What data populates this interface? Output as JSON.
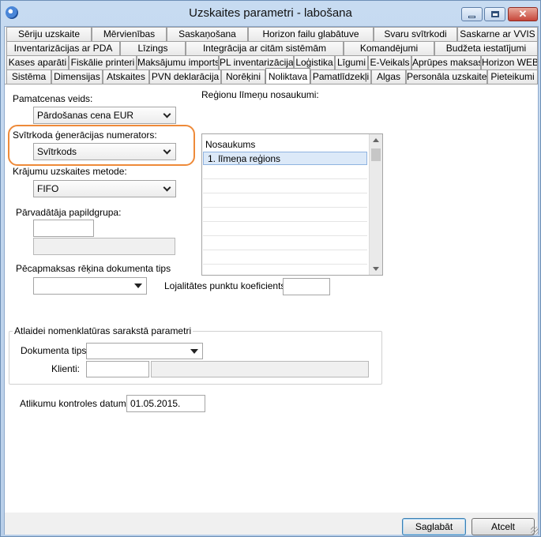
{
  "window": {
    "title": "Uzskaites parametri - labošana",
    "close_glyph": "✕"
  },
  "tabs": {
    "row1": [
      "Sēriju uzskaite",
      "Mērvienības",
      "Saskaņošana",
      "Horizon failu glabātuve",
      "Svaru svītrkodi",
      "Saskarne ar VVIS"
    ],
    "row2": [
      "Inventarizācijas ar PDA",
      "Līzings",
      "Integrācija ar citām sistēmām",
      "Komandējumi",
      "Budžeta iestatījumi"
    ],
    "row3": [
      "Kases aparāti",
      "Fiskālie printeri",
      "Maksājumu imports",
      "PL inventarizācija",
      "Loģistika",
      "Līgumi",
      "E-Veikals",
      "Aprūpes maksas",
      "Horizon WEB"
    ],
    "row4": [
      "Sistēma",
      "Dimensijas",
      "Atskaites",
      "PVN deklarācija",
      "Norēķini",
      "Noliktava",
      "Pamatlīdzekļi",
      "Algas",
      "Personāla uzskaite",
      "Pieteikumi"
    ],
    "active": "Noliktava"
  },
  "form": {
    "pamatcenas_label": "Pamatcenas veids:",
    "pamatcenas_value": "Pārdošanas cena EUR",
    "svitrkoda_label": "Svītrkoda ģenerācijas numerators:",
    "svitrkoda_value": "Svītrkods",
    "krajumu_label": "Krājumu uzskaites metode:",
    "krajumu_value": "FIFO",
    "parvadataja_label": "Pārvadātāja papildgrupa:",
    "parvadataja_code": "",
    "parvadataja_name": "",
    "pecapmaksas_label": "Pēcapmaksas rēķina dokumenta tips",
    "pecapmaksas_value": "",
    "lojalitates_label": "Lojalitātes punktu koeficients:",
    "lojalitates_value": "",
    "atlaidei_group": "Atlaidei nomenklatūras sarakstā parametri",
    "dokumenta_tips_label": "Dokumenta tips:",
    "dokumenta_tips_value": "",
    "klients_label": "Klienti:",
    "klients_code": "",
    "klients_name": "",
    "atlikumu_label": "Atlikumu kontroles datums:",
    "atlikumu_value": "01.05.2015."
  },
  "regions": {
    "label": "Reģionu līmeņu nosaukumi:",
    "column": "Nosaukums",
    "rows": [
      "1. līmeņa reģions"
    ]
  },
  "footer": {
    "save": "Saglabāt",
    "cancel": "Atcelt"
  },
  "colors": {
    "highlight": "#ee8a39",
    "close_button": "#c6463a",
    "selected_row": "#dce9f8"
  }
}
